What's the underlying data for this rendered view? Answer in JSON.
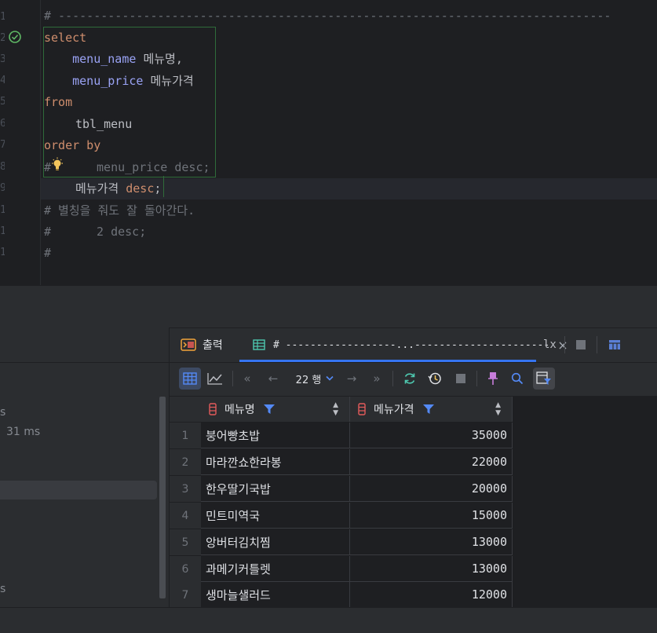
{
  "editor": {
    "lines": [
      {
        "n": "1",
        "text": "# ------------------------------------------------------------------------------"
      },
      {
        "n": "2",
        "keyword": "select"
      },
      {
        "n": "3",
        "field": "menu_name",
        "alias": "메뉴명,"
      },
      {
        "n": "4",
        "field": "menu_price",
        "alias": "메뉴가격"
      },
      {
        "n": "5",
        "keyword": "from"
      },
      {
        "n": "6",
        "text": "tbl_menu"
      },
      {
        "n": "7",
        "keyword": "order by"
      },
      {
        "n": "8",
        "prefix": "#",
        "text": "menu_price desc;"
      },
      {
        "n": "9",
        "ident": "메뉴가격",
        "keyword": "desc",
        "tail": ";"
      },
      {
        "n": "10",
        "text": "# 별칭을 줘도 잘 돌아간다."
      },
      {
        "n": "11",
        "prefix": "#",
        "text": "2 desc;"
      },
      {
        "n": "12",
        "text": "#"
      }
    ]
  },
  "left_panel": {
    "items": [
      "s",
      "31 ms",
      "s"
    ]
  },
  "tabs": {
    "output_label": "출력",
    "result_label": "# ------------------...----------------------",
    "close_glyph": "×",
    "tx_label": "lx"
  },
  "toolbar": {
    "rows_label": "22 행"
  },
  "grid": {
    "columns": [
      "메뉴명",
      "메뉴가격"
    ],
    "rows": [
      {
        "n": "1",
        "name": "붕어빵초밥",
        "price": "35000"
      },
      {
        "n": "2",
        "name": "마라깐쇼한라봉",
        "price": "22000"
      },
      {
        "n": "3",
        "name": "한우딸기국밥",
        "price": "20000"
      },
      {
        "n": "4",
        "name": "민트미역국",
        "price": "15000"
      },
      {
        "n": "5",
        "name": "앙버터김치찜",
        "price": "13000"
      },
      {
        "n": "6",
        "name": "과메기커틀렛",
        "price": "13000"
      },
      {
        "n": "7",
        "name": "생마늘샐러드",
        "price": "12000"
      }
    ]
  },
  "colors": {
    "accent": "#3574f0",
    "keyword": "#cf8e6d",
    "field": "#9aa3f5",
    "comment": "#6f737a",
    "check": "#5fb865"
  }
}
